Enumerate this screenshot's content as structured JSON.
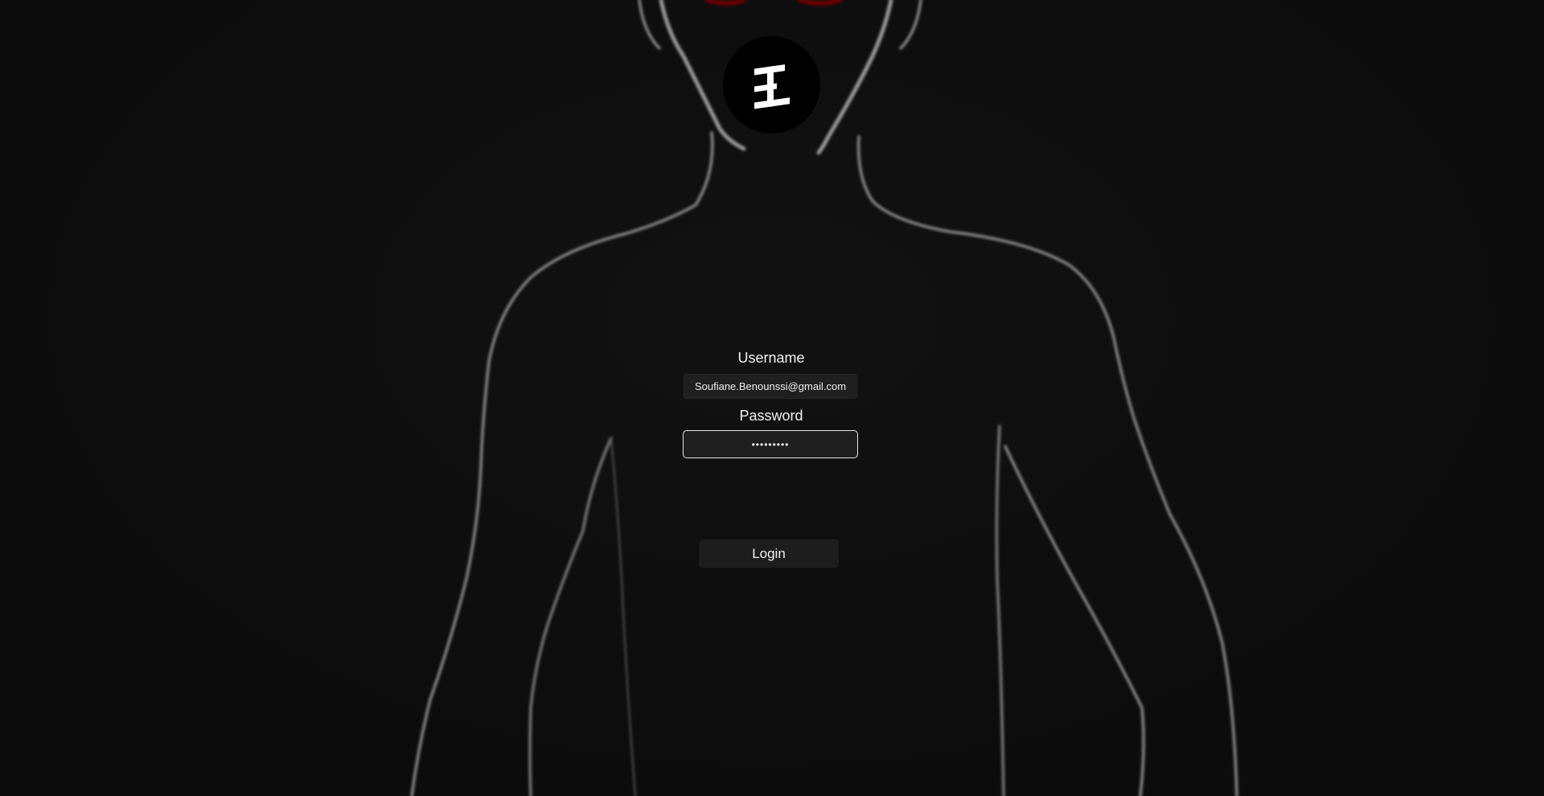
{
  "login": {
    "username_label": "Username",
    "username_value": "Soufiane.Benounssi@gmail.com",
    "password_label": "Password",
    "password_value": "•••••••••",
    "login_button": "Login"
  },
  "icons": {
    "logo": "brand-logo-icon",
    "background": "figure-silhouette-illustration"
  },
  "colors": {
    "background": "#0d0d0d",
    "field_background": "#1f1f1f",
    "accent_red": "#8b0000",
    "text": "#f2f2f2"
  }
}
